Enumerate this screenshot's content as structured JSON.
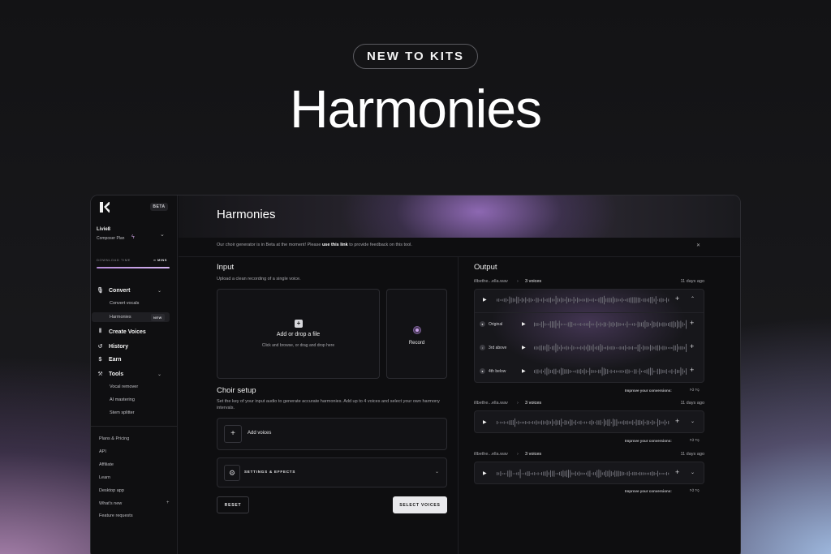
{
  "hero": {
    "pill": "NEW TO KITS",
    "title": "Harmonies"
  },
  "sidebar": {
    "beta_badge": "BETA",
    "user_name": "Livie8",
    "user_plan": "Composer Plan",
    "download_label": "DOWNLOAD TIME",
    "download_value": "∞ MINS",
    "download_fraction": 1.0,
    "nav": [
      {
        "label": "Convert",
        "icon": "mic-icon"
      },
      {
        "label": "Create Voices",
        "icon": "waveform-icon"
      },
      {
        "label": "History",
        "icon": "history-icon"
      },
      {
        "label": "Earn",
        "icon": "dollar-icon"
      },
      {
        "label": "Tools",
        "icon": "tools-icon"
      }
    ],
    "convert_sub": [
      "Convert vocals",
      "Harmonies"
    ],
    "harmonies_badge": "NEW",
    "tools_sub": [
      "Vocal remover",
      "AI mastering",
      "Stem splitter"
    ],
    "links": [
      "Plans & Pricing",
      "API",
      "Affiliate",
      "Learn",
      "Desktop app",
      "What's new",
      "Feature requests"
    ]
  },
  "main": {
    "title": "Harmonies",
    "beta_note_pre": "Our choir generator is in Beta at the moment! Please ",
    "beta_note_link": "use this link",
    "beta_note_post": " to provide feedback on this tool.",
    "input": {
      "heading": "Input",
      "sub": "Upload a clean recording of a single voice.",
      "upload_title": "Add or drop a file",
      "upload_hint": "Click and browse, or drag and drop here",
      "record_label": "Record"
    },
    "choir": {
      "heading": "Choir setup",
      "sub": "Set the key of your input audio to generate accurate harmonies. Add up to 4 voices and select your own harmony intervals.",
      "add_voices": "Add voices",
      "settings": "SETTINGS & EFFECTS"
    },
    "reset": "RESET",
    "select_voices": "SELECT VOICES"
  },
  "output": {
    "heading": "Output",
    "items": [
      {
        "file": "illbethe...ella.wav",
        "voices": "3 voices",
        "time": "11 days ago",
        "tracks": [
          "Original",
          "3rd above",
          "4th below"
        ]
      },
      {
        "file": "illbethe...ella.wav",
        "voices": "3 voices",
        "time": "11 days ago"
      },
      {
        "file": "illbethe...ella.wav",
        "voices": "3 voices",
        "time": "11 days ago"
      }
    ],
    "improve": "Improve your conversions:"
  }
}
